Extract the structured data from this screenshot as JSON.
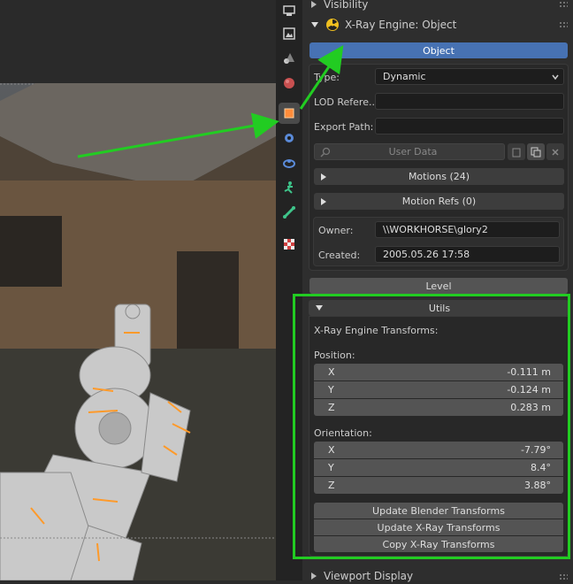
{
  "panels": {
    "visibility": "Visibility",
    "xray_object": "X-Ray Engine: Object",
    "object_button": "Object",
    "type_label": "Type:",
    "type_value": "Dynamic",
    "lod_label": "LOD Refere...",
    "lod_value": "",
    "export_label": "Export Path:",
    "export_value": "",
    "user_data_placeholder": "User Data",
    "motions": "Motions (24)",
    "motion_refs": "Motion Refs (0)",
    "owner_label": "Owner:",
    "owner_value": "\\\\WORKHORSE\\glory2",
    "created_label": "Created:",
    "created_value": "2005.05.26 17:58",
    "level_button": "Level",
    "utils": "Utils",
    "transforms_title": "X-Ray Engine Transforms:",
    "position_label": "Position:",
    "position": [
      {
        "axis": "X",
        "value": "-0.111 m"
      },
      {
        "axis": "Y",
        "value": "-0.124 m"
      },
      {
        "axis": "Z",
        "value": "0.283 m"
      }
    ],
    "orientation_label": "Orientation:",
    "orientation": [
      {
        "axis": "X",
        "value": "-7.79°"
      },
      {
        "axis": "Y",
        "value": "8.4°"
      },
      {
        "axis": "Z",
        "value": "3.88°"
      }
    ],
    "update_blender": "Update Blender Transforms",
    "update_xray": "Update X-Ray Transforms",
    "copy_xray": "Copy X-Ray Transforms",
    "viewport_display": "Viewport Display"
  },
  "tabs": [
    "render-tab-icon",
    "output-tab-icon",
    "view-layer-tab-icon",
    "scene-tab-icon",
    "world-tab-icon",
    "object-tab-icon",
    "modifiers-tab-icon",
    "particles-tab-icon",
    "physics-tab-icon",
    "constraints-tab-icon",
    "data-tab-icon",
    "texture-tab-icon"
  ],
  "colors": {
    "accent_blue": "#4772b3",
    "highlight_green": "#22cc22",
    "tab_active": "#ff8c3a"
  }
}
